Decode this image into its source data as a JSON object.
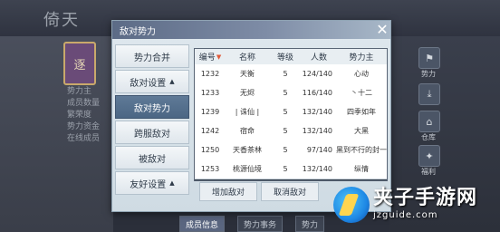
{
  "background": {
    "logo_text": "倚天",
    "emblem_text": "逐",
    "info_lines": [
      "势力主",
      "成员数量",
      "繁荣度",
      "势力资金",
      "在线成员"
    ],
    "side_icons": [
      {
        "icon": "flag-icon",
        "label": "势力"
      },
      {
        "icon": "download-icon",
        "label": ""
      },
      {
        "icon": "building-icon",
        "label": "仓库"
      },
      {
        "icon": "gift-icon",
        "label": "福利"
      }
    ],
    "bottom_tabs": [
      "成员信息",
      "势力事务",
      "势力"
    ]
  },
  "dialog": {
    "title": "敌对势力",
    "close_icon": "close-icon",
    "side_buttons": [
      {
        "label": "势力合并",
        "arrow": ""
      },
      {
        "label": "敌对设置",
        "arrow": "▲"
      },
      {
        "label": "敌对势力",
        "arrow": ""
      },
      {
        "label": "跨服敌对",
        "arrow": ""
      },
      {
        "label": "被敌对",
        "arrow": ""
      },
      {
        "label": "友好设置",
        "arrow": "▲"
      }
    ],
    "active_side": 2,
    "table": {
      "headers": [
        "编号",
        "名称",
        "等级",
        "人数",
        "势力主"
      ],
      "sort_indicator": "▼",
      "rows": [
        [
          "1232",
          "天衡",
          "5",
          "124/140",
          "心动"
        ],
        [
          "1233",
          "无烬",
          "5",
          "116/140",
          "丶十二"
        ],
        [
          "1239",
          "| 诛仙 |",
          "5",
          "132/140",
          "四季如年"
        ],
        [
          "1242",
          "宿命",
          "5",
          "132/140",
          "大黑"
        ],
        [
          "1250",
          "天香茶林",
          "5",
          "97/140",
          "黑到不行的封一"
        ],
        [
          "1253",
          "桃源仙境",
          "5",
          "132/140",
          "纵情"
        ]
      ]
    },
    "buttons": {
      "add": "增加敌对",
      "cancel": "取消敌对"
    }
  },
  "watermark": {
    "title": "夹子手游网",
    "url": "jzguide.com"
  }
}
